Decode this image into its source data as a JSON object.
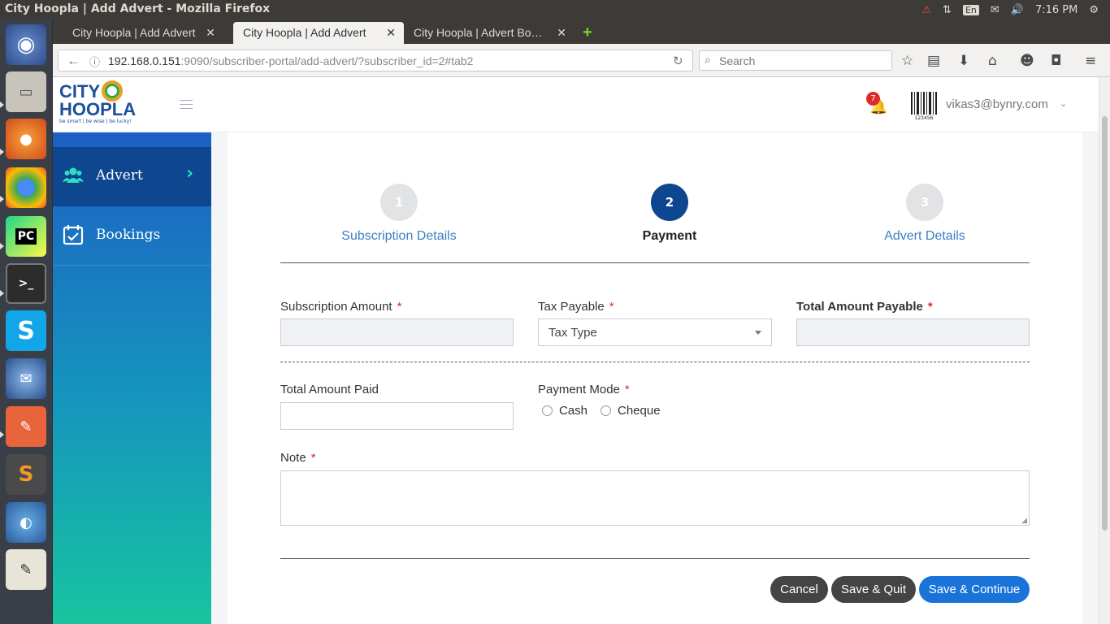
{
  "os": {
    "window_title": "City Hoopla | Add Advert - Mozilla Firefox",
    "keyboard_layout": "En",
    "clock": "7:16 PM"
  },
  "browser": {
    "tabs": [
      {
        "label": "City Hoopla | Add Advert",
        "active": false
      },
      {
        "label": "City Hoopla | Add Advert",
        "active": true
      },
      {
        "label": "City Hoopla | Advert Bo…",
        "active": false
      }
    ],
    "new_tab_label": "+",
    "url_host": "192.168.0.151",
    "url_rest": ":9090/subscriber-portal/add-advert/?subscriber_id=2#tab2",
    "search_placeholder": "Search"
  },
  "app": {
    "logo_line1": "CITY",
    "logo_line2": "HOOPLA",
    "logo_tagline": "be smart | be wise | be lucky!",
    "sidebar": [
      {
        "label": "Advert",
        "icon": "users-icon",
        "active": true
      },
      {
        "label": "Bookings",
        "icon": "calendar-check-icon",
        "active": false
      }
    ],
    "header": {
      "notification_count": "7",
      "barcode_text": "123456",
      "user_email": "vikas3@bynry.com"
    },
    "steps": [
      {
        "number": "1",
        "label": "Subscription Details",
        "active": false
      },
      {
        "number": "2",
        "label": "Payment",
        "active": true
      },
      {
        "number": "3",
        "label": "Advert Details",
        "active": false
      }
    ],
    "form": {
      "subscription_amount_label": "Subscription Amount",
      "subscription_amount_value": "",
      "tax_payable_label": "Tax Payable",
      "tax_type_selected": "Tax Type",
      "total_amount_payable_label": "Total Amount Payable",
      "total_amount_payable_value": "",
      "total_amount_paid_label": "Total Amount Paid",
      "total_amount_paid_value": "",
      "payment_mode_label": "Payment Mode",
      "payment_mode_options": [
        "Cash",
        "Cheque"
      ],
      "note_label": "Note",
      "note_value": "",
      "required_mark": "*"
    },
    "buttons": {
      "cancel": "Cancel",
      "save_quit": "Save & Quit",
      "save_continue": "Save & Continue"
    },
    "colors": {
      "primary_dark": "#0e4690",
      "accent_blue": "#1a73d9",
      "button_dark": "#444444",
      "link_blue": "#3d7fc4",
      "required_red": "#e02a2a"
    }
  }
}
